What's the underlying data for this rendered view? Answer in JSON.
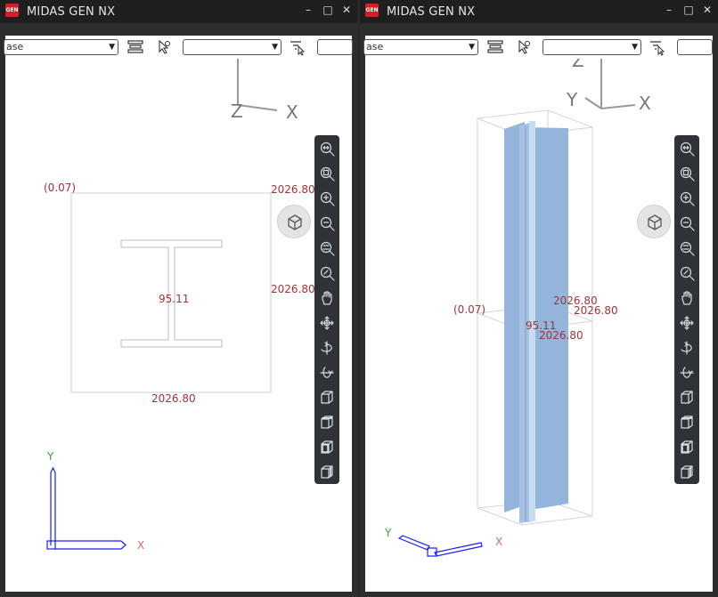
{
  "app": {
    "logo_text": "GEN",
    "title": "MIDAS GEN NX"
  },
  "window_controls": {
    "minimize": "–",
    "maximize": "□",
    "close": "✕"
  },
  "toolbar": {
    "dropdown_value": "ase"
  },
  "left_view": {
    "labels": {
      "top_left": "(0.07)",
      "top_right": "2026.80",
      "right_mid": "2026.80",
      "center": "95.11",
      "bottom": "2026.80"
    },
    "big_axes": {
      "z": "Z",
      "x": "X"
    },
    "triad": {
      "y": "Y",
      "x": "X"
    }
  },
  "right_view": {
    "labels": {
      "left": "(0.07)",
      "center": "95.11",
      "a": "2026.80",
      "b": "2026.80",
      "c": "2026.80"
    },
    "big_axes": {
      "z": "Z",
      "y": "Y",
      "x": "X"
    },
    "triad": {
      "y": "Y",
      "x": "X"
    }
  },
  "view_tools": [
    {
      "icon": "zoom-fit-icon"
    },
    {
      "icon": "zoom-window-icon"
    },
    {
      "icon": "zoom-in-icon"
    },
    {
      "icon": "zoom-out-icon"
    },
    {
      "icon": "zoom-dynamic-icon"
    },
    {
      "icon": "zoom-previous-icon"
    },
    {
      "icon": "pan-hand-icon"
    },
    {
      "icon": "rotate-icon"
    },
    {
      "icon": "rotate-horizontal-icon"
    },
    {
      "icon": "rotate-vertical-icon"
    },
    {
      "icon": "iso-view-icon"
    },
    {
      "icon": "top-view-icon"
    },
    {
      "icon": "front-view-icon"
    },
    {
      "icon": "side-view-icon"
    }
  ],
  "colors": {
    "dim_text": "#a0323a",
    "section_fill": "#93b5dc",
    "triad_blue": "#1a1aff",
    "toolbar_dark": "#2f3338"
  }
}
